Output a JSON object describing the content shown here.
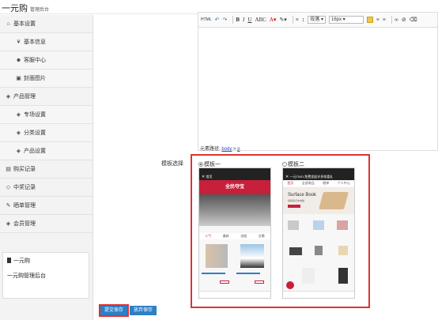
{
  "header": {
    "brand": "一元购",
    "subtitle": "管理后台"
  },
  "sidebar": {
    "items": [
      {
        "label": "基本设置",
        "icon": "home-icon",
        "glyph": "⌂",
        "level": "top"
      },
      {
        "label": "基本信息",
        "icon": "yen-icon",
        "glyph": "¥",
        "level": "sub"
      },
      {
        "label": "客服中心",
        "icon": "users-icon",
        "glyph": "☻",
        "level": "sub"
      },
      {
        "label": "封面图片",
        "icon": "image-icon",
        "glyph": "▣",
        "level": "sub"
      },
      {
        "label": "产品管理",
        "icon": "gift-icon",
        "glyph": "◈",
        "level": "top"
      },
      {
        "label": "专场设置",
        "icon": "gift-icon",
        "glyph": "◈",
        "level": "sub"
      },
      {
        "label": "分类设置",
        "icon": "gift-icon",
        "glyph": "◈",
        "level": "sub"
      },
      {
        "label": "产品设置",
        "icon": "gift-icon",
        "glyph": "◈",
        "level": "sub"
      },
      {
        "label": "购买记录",
        "icon": "file-icon",
        "glyph": "▤",
        "level": "top"
      },
      {
        "label": "中奖记录",
        "icon": "diamond-icon",
        "glyph": "◇",
        "level": "top"
      },
      {
        "label": "晒单管理",
        "icon": "edit-icon",
        "glyph": "✎",
        "level": "top"
      },
      {
        "label": "会员管理",
        "icon": "gift-icon",
        "glyph": "◈",
        "level": "top"
      }
    ],
    "card": {
      "title": "一元购",
      "subtitle": "一元购管理后台"
    }
  },
  "editor": {
    "toolbar": {
      "font_format": "段落",
      "font_size": "16px",
      "html_label": "HTML"
    },
    "path_label": "元素路径:",
    "path_body": "body",
    "path_sep": " > ",
    "path_p": "p"
  },
  "template": {
    "label": "模板选择",
    "option1": "模板一",
    "option2": "模板二",
    "phone1": {
      "nav_title": "首页",
      "banner": "全民夺宝",
      "tabs": [
        "人气",
        "最新",
        "进度",
        "总需"
      ]
    },
    "phone2": {
      "nav_title": "一元TWO-免费发起许多惊喜礼",
      "tabs": [
        "首页",
        "全部商品",
        "晒单",
        "个人中心"
      ],
      "banner_title": "Surface Book",
      "banner_sub": "终极笔记本电脑"
    }
  },
  "actions": {
    "save": "提交保存",
    "discard": "放弃保存"
  },
  "colors": {
    "accent": "#2d7fc6",
    "highlight": "#dd3333",
    "brand_red": "#c8203a"
  }
}
